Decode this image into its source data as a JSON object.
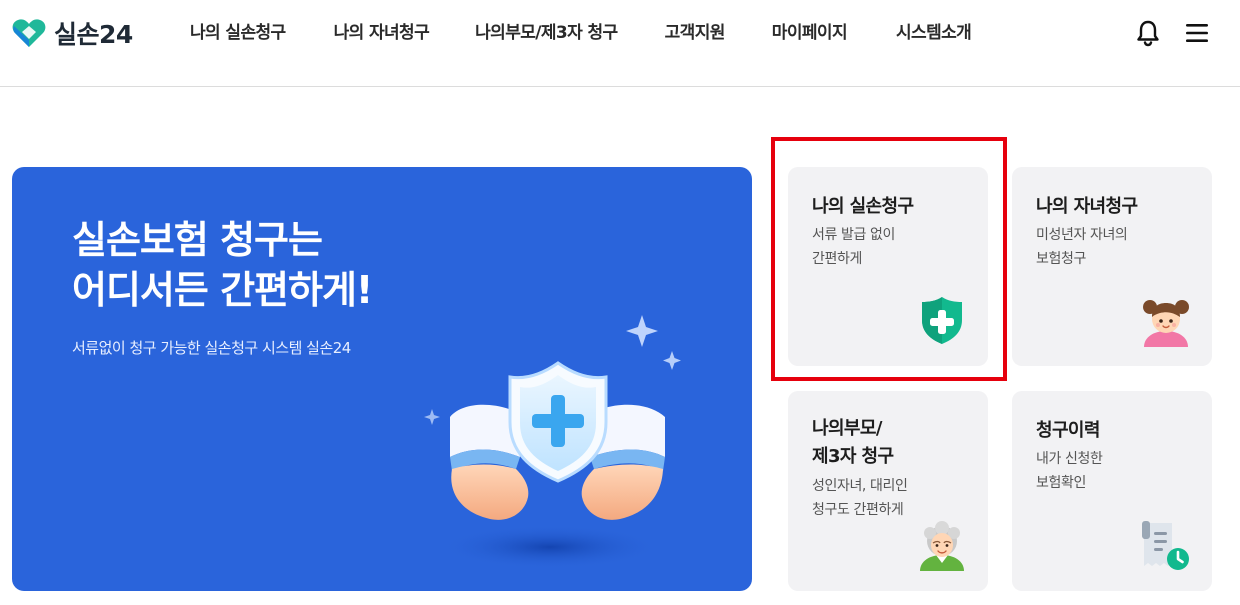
{
  "brand": {
    "name": "실손24",
    "logo_icon": "heart-logo-icon",
    "colors": {
      "teal": "#1fb89a",
      "blue": "#2a64db"
    }
  },
  "nav": {
    "items": [
      {
        "label": "나의 실손청구"
      },
      {
        "label": "나의 자녀청구"
      },
      {
        "label": "나의부모/제3자 청구"
      },
      {
        "label": "고객지원"
      },
      {
        "label": "마이페이지"
      },
      {
        "label": "시스템소개"
      }
    ],
    "icons": [
      "bell-icon",
      "hamburger-menu-icon"
    ]
  },
  "hero": {
    "title_line1": "실손보험 청구는",
    "title_line2": "어디서든 간편하게!",
    "subtitle": "서류없이 청구 가능한 실손청구 시스템 실손24",
    "background": "#2a64db"
  },
  "cards": [
    {
      "title": "나의 실손청구",
      "desc_line1": "서류 발급 없이",
      "desc_line2": "간편하게",
      "icon": "green-shield-plus-icon",
      "highlighted": true
    },
    {
      "title": "나의 자녀청구",
      "desc_line1": "미성년자 자녀의",
      "desc_line2": "보험청구",
      "icon": "child-avatar-icon"
    },
    {
      "title_line1": "나의부모/",
      "title_line2": "제3자 청구",
      "desc_line1": "성인자녀, 대리인",
      "desc_line2": "청구도 간편하게",
      "icon": "elderly-avatar-icon"
    },
    {
      "title": "청구이력",
      "desc_line1": "내가 신청한",
      "desc_line2": "보험확인",
      "icon": "receipt-clock-icon"
    }
  ],
  "highlight_color": "#e6000d"
}
